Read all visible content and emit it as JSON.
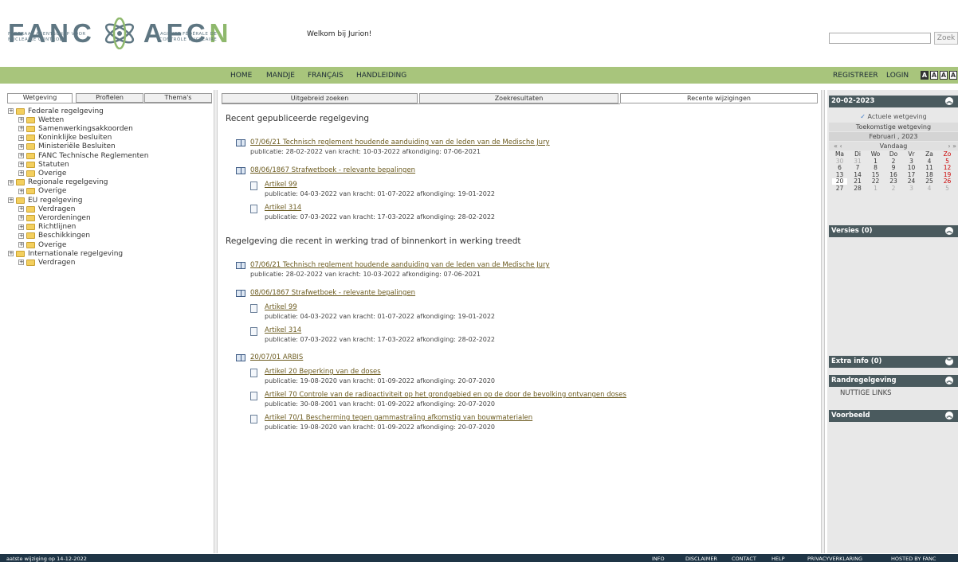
{
  "header": {
    "logo_left": "FANC",
    "logo_right": "AFCN",
    "logo_sub_left_1": "FEDERAAL AGENTSCHAP VOOR",
    "logo_sub_left_2": "NUCLEAIRE CONTROLE",
    "logo_sub_right_1": "AGENCE FÉDÉRALE DE",
    "logo_sub_right_2": "CONTRÔLE NUCLÉAIRE",
    "welcome": "Welkom bij Jurion!",
    "search_placeholder": "",
    "search_button": "Zoek"
  },
  "nav": {
    "items": [
      "HOME",
      "MANDJE",
      "FRANÇAIS",
      "HANDLEIDING"
    ],
    "right": [
      "REGISTREER",
      "LOGIN"
    ],
    "sizes": [
      "A",
      "A",
      "A",
      "A"
    ]
  },
  "left": {
    "tabs": [
      "Wetgeving",
      "Profielen",
      "Thema's"
    ],
    "tree": [
      {
        "label": "Federale regelgeving",
        "level": 0
      },
      {
        "label": "Wetten",
        "level": 1
      },
      {
        "label": "Samenwerkingsakkoorden",
        "level": 1
      },
      {
        "label": "Koninklijke besluiten",
        "level": 1
      },
      {
        "label": "Ministeriële Besluiten",
        "level": 1
      },
      {
        "label": "FANC Technische Reglementen",
        "level": 1
      },
      {
        "label": "Statuten",
        "level": 1
      },
      {
        "label": "Overige",
        "level": 1
      },
      {
        "label": "Regionale regelgeving",
        "level": 0
      },
      {
        "label": "Overige",
        "level": 1
      },
      {
        "label": "EU regelgeving",
        "level": 0
      },
      {
        "label": "Verdragen",
        "level": 1
      },
      {
        "label": "Verordeningen",
        "level": 1
      },
      {
        "label": "Richtlijnen",
        "level": 1
      },
      {
        "label": "Beschikkingen",
        "level": 1
      },
      {
        "label": "Overige",
        "level": 1
      },
      {
        "label": "Internationale regelgeving",
        "level": 0
      },
      {
        "label": "Verdragen",
        "level": 1
      }
    ]
  },
  "middle": {
    "tabs": [
      "Uitgebreid zoeken",
      "Zoekresultaten",
      "Recente wijzigingen"
    ],
    "section1_title": "Recent gepubliceerde regelgeving",
    "section2_title": "Regelgeving die recent in werking trad of binnenkort in werking treedt",
    "s1": [
      {
        "link": "07/06/21 Technisch reglement houdende aanduiding van de leden van de Medische Jury",
        "meta": "publicatie: 28-02-2022    van kracht: 10-03-2022    afkondiging: 07-06-2021"
      },
      {
        "link": "08/06/1867 Strafwetboek - relevante bepalingen",
        "meta": ""
      },
      {
        "link": "Artikel 99",
        "meta": "publicatie: 04-03-2022    van kracht: 01-07-2022    afkondiging: 19-01-2022"
      },
      {
        "link": "Artikel 314",
        "meta": "publicatie: 07-03-2022    van kracht: 17-03-2022    afkondiging: 28-02-2022"
      }
    ],
    "s2": [
      {
        "link": "07/06/21 Technisch reglement houdende aanduiding van de leden van de Medische Jury",
        "meta": "publicatie: 28-02-2022    van kracht: 10-03-2022    afkondiging: 07-06-2021"
      },
      {
        "link": "08/06/1867 Strafwetboek - relevante bepalingen",
        "meta": ""
      },
      {
        "link": "Artikel 99",
        "meta": "publicatie: 04-03-2022    van kracht: 01-07-2022    afkondiging: 19-01-2022"
      },
      {
        "link": "Artikel 314",
        "meta": "publicatie: 07-03-2022    van kracht: 17-03-2022    afkondiging: 28-02-2022"
      },
      {
        "link": "20/07/01 ARBIS",
        "meta": ""
      },
      {
        "link": "Artikel 20 Beperking van de doses",
        "meta": "publicatie: 19-08-2020    van kracht: 01-09-2022    afkondiging: 20-07-2020"
      },
      {
        "link": "Artikel 70 Controle van de radioactiviteit op het grondgebied en op de door de bevolking ontvangen doses",
        "meta": "publicatie: 30-08-2001    van kracht: 01-09-2022    afkondiging: 20-07-2020"
      },
      {
        "link": "Artikel 70/1 Bescherming tegen gammastraling afkomstig van bouwmaterialen",
        "meta": "publicatie: 19-08-2020    van kracht: 01-09-2022    afkondiging: 20-07-2020"
      }
    ]
  },
  "right": {
    "date": "20-02-2023",
    "current": "Actuele wetgeving",
    "future": "Toekomstige wetgeving",
    "month": "Februari , 2023",
    "nav_prev": "« ‹",
    "today": "Vandaag",
    "nav_next": "› »",
    "weekdays": [
      "Ma",
      "Di",
      "Wo",
      "Do",
      "Vr",
      "Za",
      "Zo"
    ],
    "weeks": [
      [
        "30",
        "31",
        "1",
        "2",
        "3",
        "4",
        "5"
      ],
      [
        "6",
        "7",
        "8",
        "9",
        "10",
        "11",
        "12"
      ],
      [
        "13",
        "14",
        "15",
        "16",
        "17",
        "18",
        "19"
      ],
      [
        "20",
        "21",
        "22",
        "23",
        "24",
        "25",
        "26"
      ],
      [
        "27",
        "28",
        "1",
        "2",
        "3",
        "4",
        "5"
      ]
    ],
    "versies": "Versies (0)",
    "extra": "Extra info (0)",
    "rand": "Randregelgeving",
    "nuttige": "NUTTIGE LINKS",
    "voorbeeld": "Voorbeeld"
  },
  "footer": {
    "left": "aatste wijziging op 14-12-2022",
    "links": [
      "INFO",
      "DISCLAIMER",
      "CONTACT",
      "HELP",
      "PRIVACYVERKLARING",
      "HOSTED BY FANC"
    ]
  }
}
